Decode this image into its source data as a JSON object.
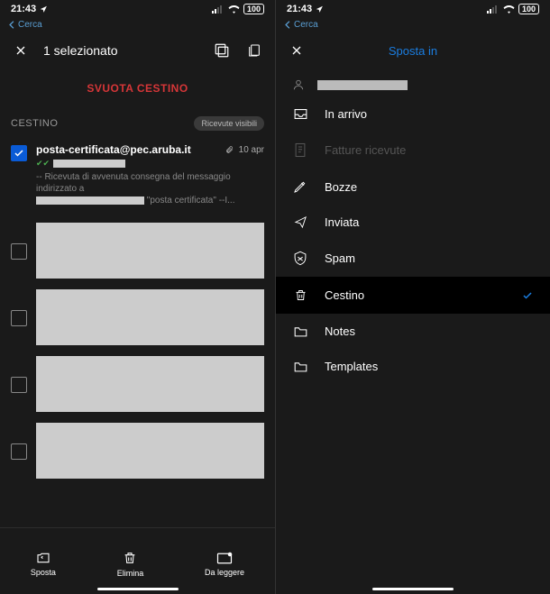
{
  "statusbar": {
    "time": "21:43",
    "search": "Cerca",
    "wifi": "100"
  },
  "left": {
    "selection": "1 selezionato",
    "empty_trash": "SVUOTA CESTINO",
    "section": "CESTINO",
    "pill": "Ricevute visibili",
    "mail": {
      "sender": "posta-certificata@pec.aruba.it",
      "date": "10 apr",
      "snippet1": "-- Ricevuta di avvenuta consegna del messaggio indirizzato a",
      "snippet2": "\"posta certificata\" --I..."
    },
    "bottom": {
      "move": "Sposta",
      "delete": "Elimina",
      "unread": "Da leggere"
    }
  },
  "right": {
    "title": "Sposta in",
    "folders": {
      "inbox": "In arrivo",
      "invoices": "Fatture ricevute",
      "drafts": "Bozze",
      "sent": "Inviata",
      "spam": "Spam",
      "trash": "Cestino",
      "notes": "Notes",
      "templates": "Templates"
    }
  }
}
